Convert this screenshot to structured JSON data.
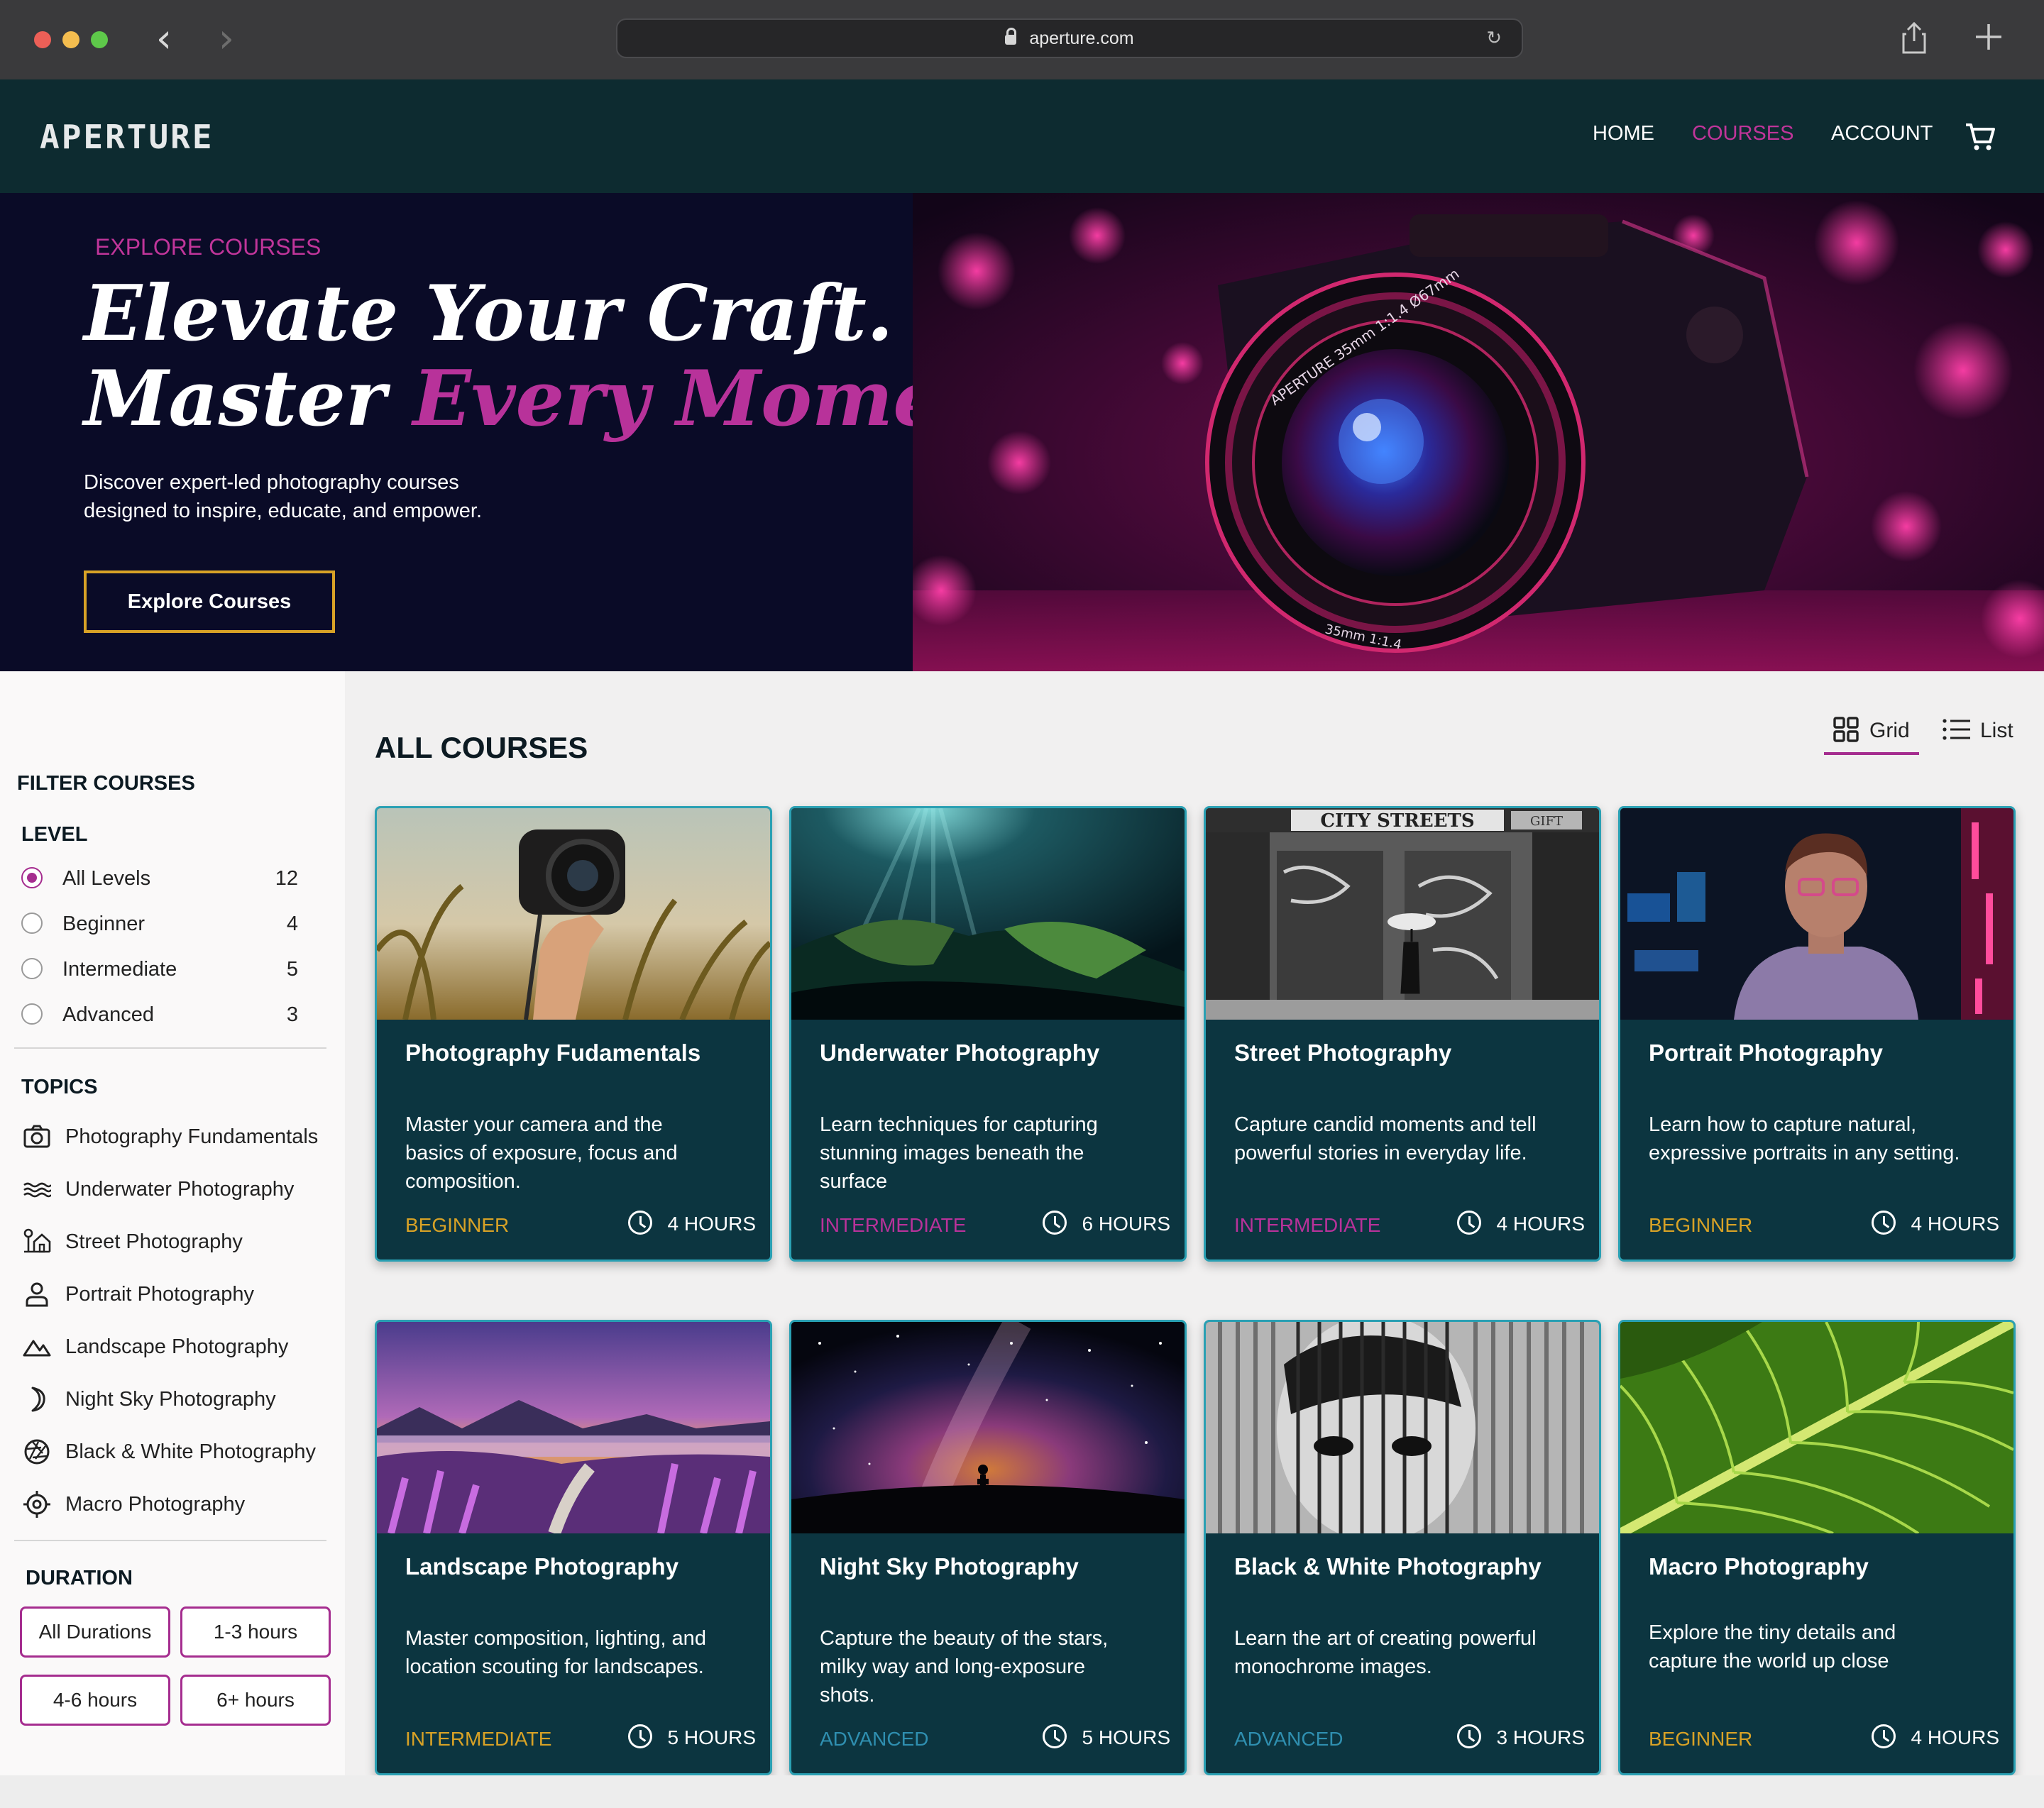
{
  "browser": {
    "url": "aperture.com"
  },
  "header": {
    "logo": "APERTURE",
    "nav": [
      {
        "label": "HOME",
        "color": "#ffffff"
      },
      {
        "label": "COURSES",
        "color": "#c0359a"
      },
      {
        "label": "ACCOUNT",
        "color": "#ffffff"
      }
    ]
  },
  "hero": {
    "eyebrow": "EXPLORE COURSES",
    "title_line1": "Elevate Your Craft.",
    "title_line2_a": "Master ",
    "title_line2_b": "Every Moment",
    "description": "Discover expert-led photography courses designed to inspire, educate, and empower.",
    "button": "Explore Courses",
    "lens_text": "APERTURE 35mm 1:1.4 Ø67mm",
    "lens_text_2": "35mm 1:1.4"
  },
  "sidebar": {
    "title": "FILTER COURSES",
    "level_heading": "LEVEL",
    "levels": [
      {
        "label": "All Levels",
        "count": "12",
        "selected": true
      },
      {
        "label": "Beginner",
        "count": "4",
        "selected": false
      },
      {
        "label": "Intermediate",
        "count": "5",
        "selected": false
      },
      {
        "label": "Advanced",
        "count": "3",
        "selected": false
      }
    ],
    "topics_heading": "TOPICS",
    "topics": [
      {
        "label": "Photography Fundamentals",
        "icon": "camera-icon"
      },
      {
        "label": "Underwater Photography",
        "icon": "waves-icon"
      },
      {
        "label": "Street Photography",
        "icon": "street-icon"
      },
      {
        "label": "Portrait Photography",
        "icon": "person-icon"
      },
      {
        "label": "Landscape Photography",
        "icon": "mountain-icon"
      },
      {
        "label": "Night Sky Photography",
        "icon": "moon-icon"
      },
      {
        "label": "Black & White Photography",
        "icon": "aperture-icon"
      },
      {
        "label": "Macro Photography",
        "icon": "target-icon"
      }
    ],
    "duration_heading": "DURATION",
    "durations": [
      "All Durations",
      "1-3 hours",
      "4-6 hours",
      "6+ hours"
    ]
  },
  "main": {
    "title": "ALL COURSES",
    "view_grid": "Grid",
    "view_list": "List"
  },
  "colors": {
    "beginner": "#d8a226",
    "intermediate": "#b8329a",
    "advanced": "#2f8fb0"
  },
  "courses": [
    {
      "title": "Photography Fudamentals",
      "desc": "Master your camera and the basics of exposure, focus and composition.",
      "level": "BEGINNER",
      "duration": "4 HOURS"
    },
    {
      "title": "Underwater Photography",
      "desc": "Learn techniques for capturing stunning images beneath the surface",
      "level": "INTERMEDIATE",
      "duration": "6 HOURS"
    },
    {
      "title": "Street Photography",
      "desc": "Capture candid moments and tell powerful stories in everyday life.",
      "level": "INTERMEDIATE",
      "duration": "4 HOURS"
    },
    {
      "title": "Portrait Photography",
      "desc": "Learn how to capture natural, expressive portraits in any setting.",
      "level": "BEGINNER",
      "duration": "4 HOURS"
    },
    {
      "title": "Landscape Photography",
      "desc": "Master composition, lighting, and location scouting for landscapes.",
      "level": "INTERMEDIATE",
      "duration": "5 HOURS"
    },
    {
      "title": "Night Sky Photography",
      "desc": "Capture the beauty of the stars, milky way and long-exposure shots.",
      "level": "ADVANCED",
      "duration": "5 HOURS"
    },
    {
      "title": "Black & White Photography",
      "desc": "Learn the art of creating powerful monochrome images.",
      "level": "ADVANCED",
      "duration": "3 HOURS"
    },
    {
      "title": "Macro Photography",
      "desc": "Explore the tiny details and capture the world up close",
      "level": "BEGINNER",
      "duration": "4 HOURS"
    }
  ],
  "street_sign": "CITY STREETS",
  "street_sign_small": "GIFT"
}
